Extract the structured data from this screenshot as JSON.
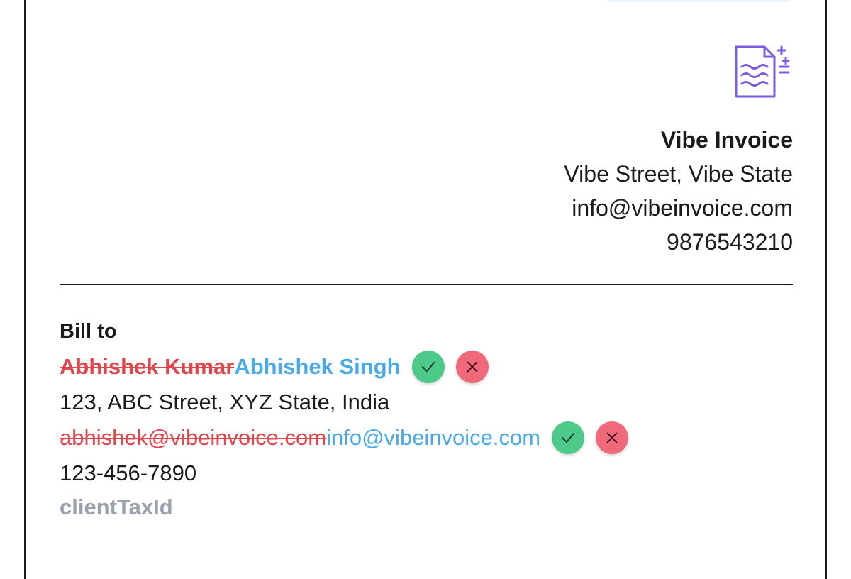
{
  "company": {
    "logo_icon": "document-sparkle-icon",
    "name": "Vibe Invoice",
    "address": "Vibe Street, Vibe State",
    "email": "info@vibeinvoice.com",
    "phone": "9876543210"
  },
  "bill_to": {
    "title": "Bill to",
    "name_old": "Abhishek Kumar",
    "name_new": "Abhishek Singh",
    "address": "123, ABC Street, XYZ State, India",
    "email_old": "abhishek@vibeinvoice.com",
    "email_new": "info@vibeinvoice.com",
    "phone": "123-456-7890",
    "tax_id_placeholder": "clientTaxId"
  },
  "colors": {
    "accent_purple": "#7c5ce0",
    "removed_red": "#e0474c",
    "added_blue": "#4aa9e8",
    "accept_green": "#4dc98a",
    "reject_red": "#f0697a",
    "placeholder_gray": "#9aa1ad"
  },
  "icons": {
    "accept": "check-icon",
    "reject": "close-icon"
  }
}
